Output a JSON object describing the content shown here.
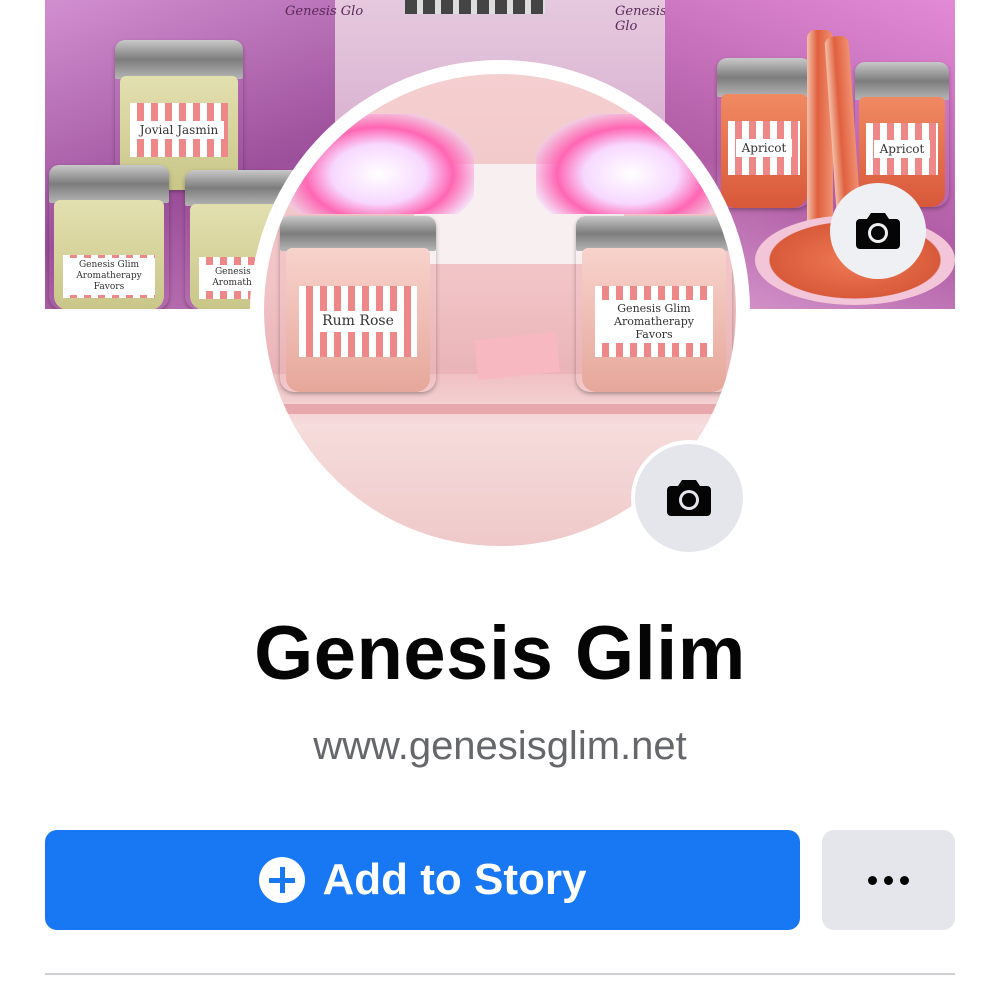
{
  "cover": {
    "watermark_left": "Genesis Glo",
    "watermark_right": "Genesis Glo",
    "jar_labels": [
      "Jovial Jasmin",
      "Genesis Glim Aromatherapy Favors",
      "Genesis Glim Aromatherapy",
      "Apricot",
      "Apricot"
    ],
    "camera_icon": "camera-icon"
  },
  "profile": {
    "jar_labels": [
      "Rum Rose",
      "Genesis Glim Aromatherapy Favors"
    ],
    "camera_icon": "camera-icon"
  },
  "page": {
    "name": "Genesis Glim",
    "website": "www.genesisglim.net"
  },
  "actions": {
    "add_story_label": "Add to Story",
    "add_story_icon": "plus-circle-icon",
    "more_icon": "more-dots-icon"
  },
  "colors": {
    "primary_button": "#1877f2",
    "secondary_button": "#e4e6eb",
    "name_text": "#050505",
    "secondary_text": "#65676b"
  }
}
